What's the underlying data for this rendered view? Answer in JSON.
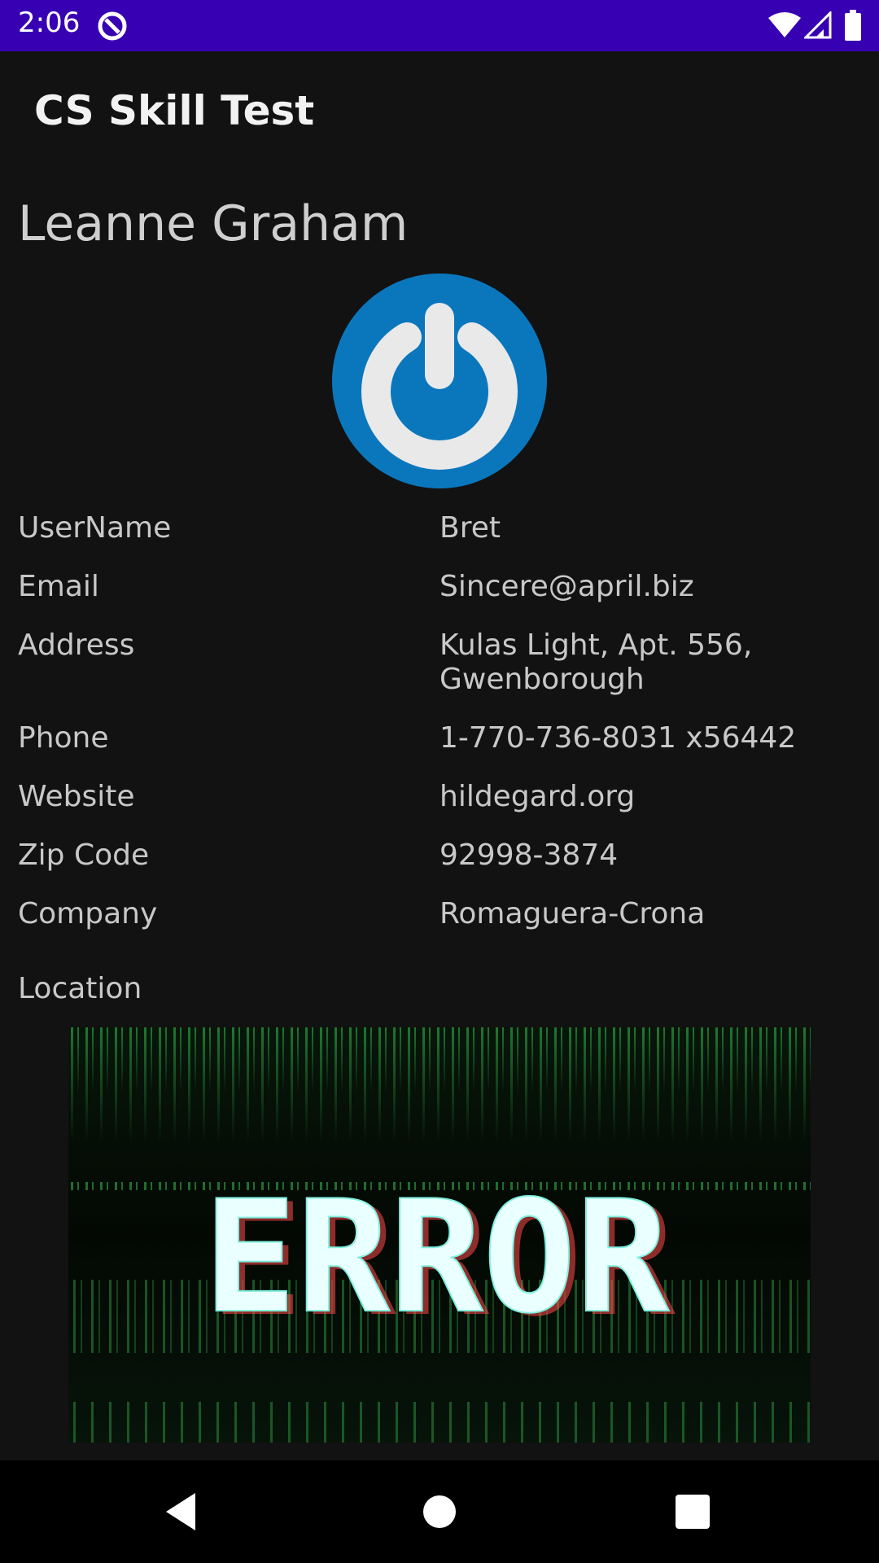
{
  "status_bar": {
    "time": "2:06",
    "icons": [
      "app-notification-icon",
      "wifi-icon",
      "cell-signal-icon",
      "battery-icon"
    ]
  },
  "app_bar": {
    "title": "CS Skill Test"
  },
  "profile": {
    "name": "Leanne Graham",
    "avatar_icon": "power-button-icon",
    "details": [
      {
        "label": "UserName",
        "value": "Bret"
      },
      {
        "label": "Email",
        "value": "Sincere@april.biz"
      },
      {
        "label": "Address",
        "value": "Kulas Light, Apt. 556,\nGwenborough"
      },
      {
        "label": "Phone",
        "value": "1-770-736-8031 x56442"
      },
      {
        "label": "Website",
        "value": "hildegard.org"
      },
      {
        "label": "Zip Code",
        "value": "92998-3874"
      },
      {
        "label": "Company",
        "value": "Romaguera-Crona"
      }
    ],
    "location_label": "Location",
    "map_image_text": "ERROR"
  },
  "nav_bar": {
    "buttons": [
      "back-icon",
      "home-icon",
      "recents-icon"
    ]
  },
  "colors": {
    "status_bar": "#3700b3",
    "background": "#121212",
    "avatar_blue": "#0a77bd"
  }
}
